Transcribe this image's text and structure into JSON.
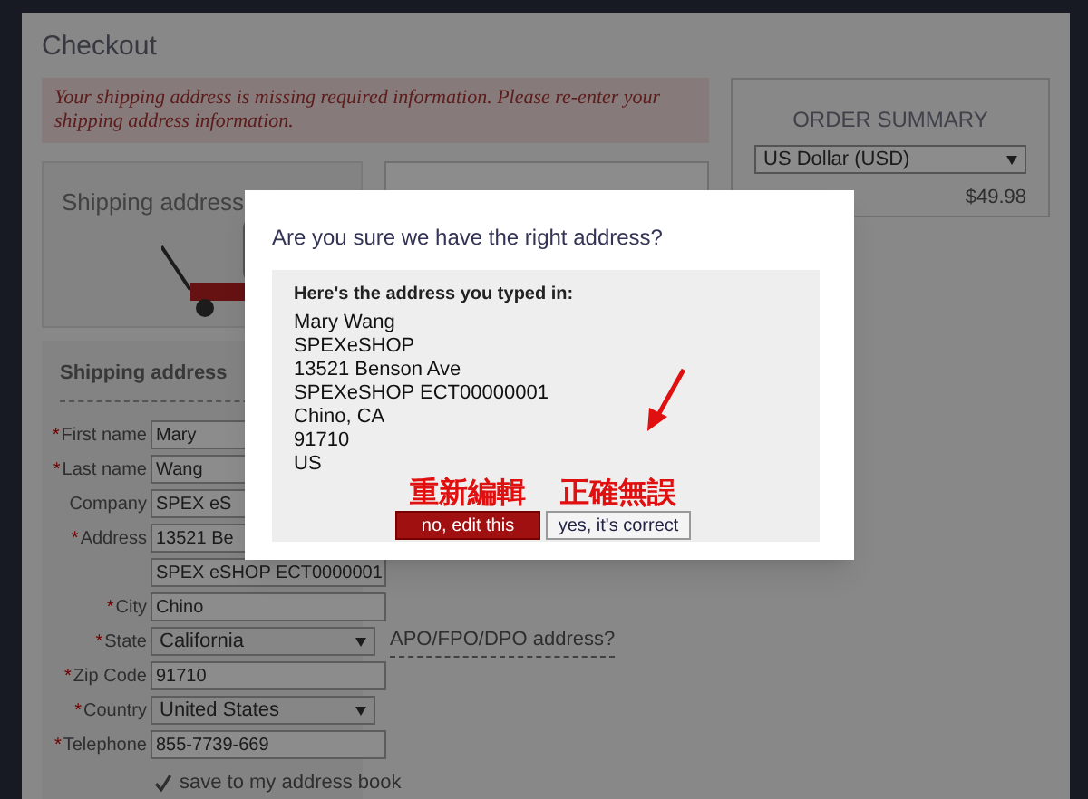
{
  "page": {
    "title": "Checkout",
    "error": "Your shipping address is missing required information. Please re-enter your shipping address information.",
    "promo_title": "Shipping address"
  },
  "form": {
    "heading": "Shipping address",
    "fields": [
      {
        "marker": "*",
        "label": "First name",
        "kind": "text",
        "value": "Mary"
      },
      {
        "marker": "*",
        "label": "Last name",
        "kind": "text",
        "value": "Wang"
      },
      {
        "label": "Company",
        "kind": "text",
        "value": "SPEX eS"
      },
      {
        "marker": "*",
        "label": "Address",
        "kind": "text",
        "value": "13521 Be"
      },
      {
        "kind": "text",
        "value": "SPEX eSHOP ECT0000001"
      },
      {
        "marker": "*",
        "label": "City",
        "kind": "text",
        "value": "Chino"
      },
      {
        "marker": "*",
        "label": "State",
        "kind": "select",
        "value": "California",
        "link": "APO/FPO/DPO address?"
      },
      {
        "marker": "*",
        "label": "Zip Code",
        "kind": "text",
        "value": "91710"
      },
      {
        "marker": "*",
        "label": "Country",
        "kind": "select",
        "value": "United States"
      },
      {
        "marker": "*",
        "label": "Telephone",
        "kind": "text",
        "value": "855-7739-669"
      }
    ],
    "save": {
      "label": "save to my address book",
      "checked": true
    }
  },
  "order_summary": {
    "title": "ORDER SUMMARY",
    "currency": "US Dollar (USD)",
    "amount": "$49.98"
  },
  "dialog": {
    "title": "Are you sure we have the right address?",
    "heading": "Here's the address you typed in:",
    "lines": [
      "Mary Wang",
      "SPEXeSHOP",
      "13521 Benson Ave",
      "SPEXeSHOP ECT00000001",
      "Chino, CA",
      "91710",
      "US"
    ],
    "buttons": [
      {
        "label": "no, edit this",
        "kind": "primary",
        "annotation": "重新編輯"
      },
      {
        "label": "yes, it's correct",
        "kind": "secondary",
        "annotation": "正確無誤"
      }
    ]
  }
}
